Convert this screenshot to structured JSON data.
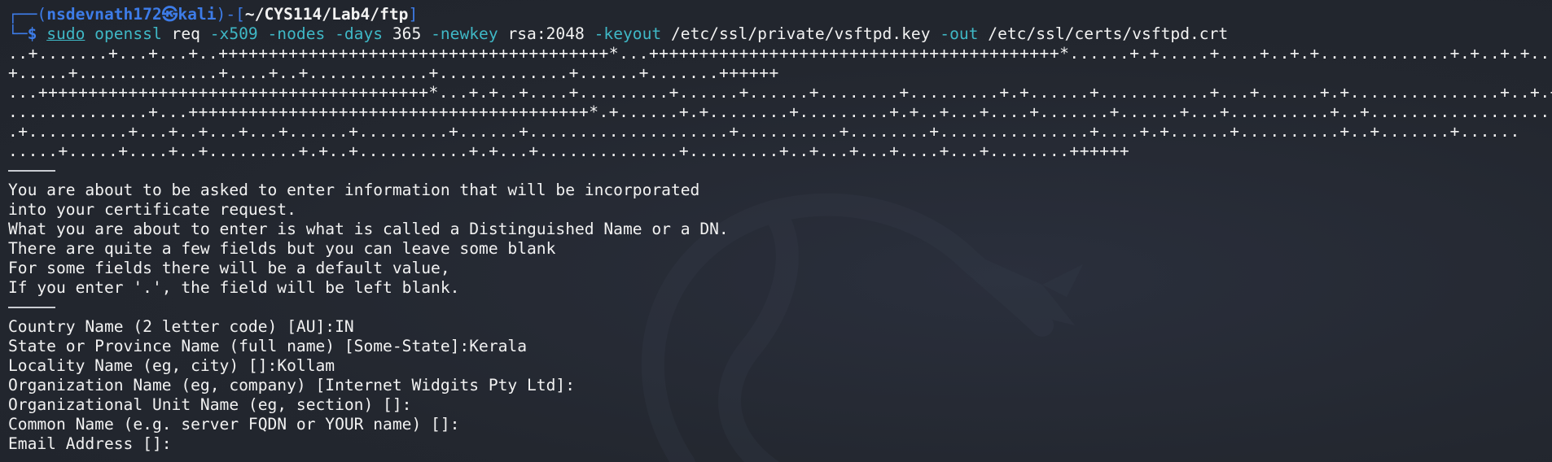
{
  "prompt": {
    "frame_top": "┌──(",
    "user": "nsdevnath172",
    "at_symbol": "㉿",
    "host": "kali",
    "mid": ")-[",
    "path": "~/CYS114/Lab4/ftp",
    "close": "]",
    "frame_bottom": "└─",
    "dollar": "$"
  },
  "command": {
    "sudo": "sudo",
    "exe": "openssl",
    "sub": "req",
    "opt1": "-x509",
    "opt2": "-nodes",
    "opt3": "-days",
    "arg3": "365",
    "opt4": "-newkey",
    "arg4": "rsa:2048",
    "opt5": "-keyout",
    "arg5": "/etc/ssl/private/vsftpd.key",
    "opt6": "-out",
    "arg6": "/etc/ssl/certs/vsftpd.crt"
  },
  "progress_lines": [
    "..+.......+...+...+..+++++++++++++++++++++++++++++++++++++++*...+++++++++++++++++++++++++++++++++++++++++*......+.+.....+....+..+.+.............+.+..+.+......",
    "+.....+..............+....+..+............+.............+......+.......++++++",
    "...+++++++++++++++++++++++++++++++++++++++*...+.+..+....+.........+......+......+........+.........+.+......+...........+...+......+.+...............+..+.+..",
    "..............+...++++++++++++++++++++++++++++++++++++++++*.+......+.+........+.........+.+..+...+....+.......+......+...+..........+..+..................",
    ".+..........+...+..+...+...+......+.........+......+....................+..........+........+...............+....+.+......+..........+..+.......+......",
    ".....+.....+....+..+.........+.+..+...........+.+...+..............+.........+..+...+...+....+...+........++++++"
  ],
  "info_lines": [
    "You are about to be asked to enter information that will be incorporated",
    "into your certificate request.",
    "What you are about to enter is what is called a Distinguished Name or a DN.",
    "There are quite a few fields but you can leave some blank",
    "For some fields there will be a default value,",
    "If you enter '.', the field will be left blank."
  ],
  "fields": [
    {
      "prompt": "Country Name (2 letter code) [AU]:",
      "value": "IN"
    },
    {
      "prompt": "State or Province Name (full name) [Some-State]:",
      "value": "Kerala"
    },
    {
      "prompt": "Locality Name (eg, city) []:",
      "value": "Kollam"
    },
    {
      "prompt": "Organization Name (eg, company) [Internet Widgits Pty Ltd]:",
      "value": ""
    },
    {
      "prompt": "Organizational Unit Name (eg, section) []:",
      "value": ""
    },
    {
      "prompt": "Common Name (e.g. server FQDN or YOUR name) []:",
      "value": ""
    },
    {
      "prompt": "Email Address []:",
      "value": ""
    }
  ],
  "colors": {
    "background": "#23272f",
    "prompt_blue": "#3d7ce8",
    "command_cyan": "#3fb8c6",
    "text": "#f2f2f2"
  },
  "watermark_icon": "kali-dragon-icon"
}
